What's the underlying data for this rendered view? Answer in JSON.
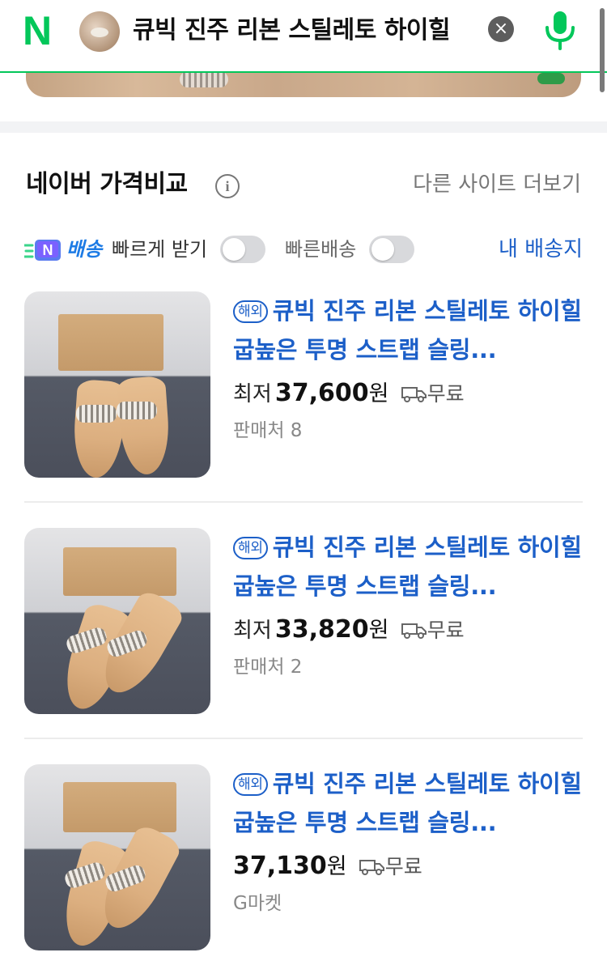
{
  "header": {
    "logo": "N",
    "query": "큐빅 진주 리본 스틸레토 하이힐",
    "clear_icon": "×"
  },
  "section": {
    "title": "네이버 가격비교",
    "info_icon": "i",
    "more_link": "다른 사이트 더보기"
  },
  "filters": {
    "npay_label": "배송",
    "fast_receive_label": "빠르게 받기",
    "fast_delivery_label": "빠른배송",
    "address_link": "내 배송지"
  },
  "products": [
    {
      "tag": "해외",
      "title": "큐빅 진주 리본 스틸레토 하이힐 굽높은 투명 스트랩 슬링...",
      "price_prefix": "최저",
      "price": "37,600",
      "unit": "원",
      "shipping": "무료",
      "seller": "판매처 8"
    },
    {
      "tag": "해외",
      "title": "큐빅 진주 리본 스틸레토 하이힐 굽높은 투명 스트랩 슬링...",
      "price_prefix": "최저",
      "price": "33,820",
      "unit": "원",
      "shipping": "무료",
      "seller": "판매처 2"
    },
    {
      "tag": "해외",
      "title": "큐빅 진주 리본 스틸레토 하이힐 굽높은 투명 스트랩 슬링...",
      "price_prefix": "",
      "price": "37,130",
      "unit": "원",
      "shipping": "무료",
      "seller": "G마켓"
    }
  ],
  "colors": {
    "brand_green": "#03c75a",
    "link_blue": "#1c5fc8"
  }
}
